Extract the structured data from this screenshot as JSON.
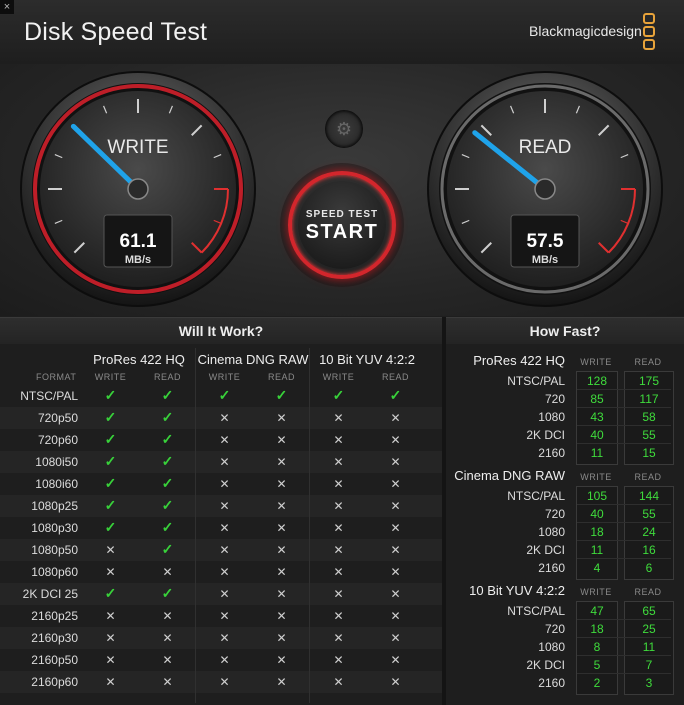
{
  "window": {
    "close_glyph": "×"
  },
  "header": {
    "title": "Disk Speed Test",
    "brand": "Blackmagicdesign"
  },
  "write_gauge": {
    "label": "WRITE",
    "value": "61.1",
    "unit": "MB/s",
    "needle_fraction": 0.33
  },
  "read_gauge": {
    "label": "READ",
    "value": "57.5",
    "unit": "MB/s",
    "needle_fraction": 0.31
  },
  "start_button": {
    "small": "SPEED TEST",
    "big": "START"
  },
  "settings_icon": "gear-icon",
  "will_it_work": {
    "title": "Will It Work?",
    "format_header": "FORMAT",
    "write_header": "WRITE",
    "read_header": "READ",
    "groups": [
      "ProRes 422 HQ",
      "Cinema DNG RAW",
      "10 Bit YUV 4:2:2"
    ],
    "rows": [
      {
        "format": "NTSC/PAL",
        "cells": [
          1,
          1,
          1,
          1,
          1,
          1
        ]
      },
      {
        "format": "720p50",
        "cells": [
          1,
          1,
          0,
          0,
          0,
          0
        ]
      },
      {
        "format": "720p60",
        "cells": [
          1,
          1,
          0,
          0,
          0,
          0
        ]
      },
      {
        "format": "1080i50",
        "cells": [
          1,
          1,
          0,
          0,
          0,
          0
        ]
      },
      {
        "format": "1080i60",
        "cells": [
          1,
          1,
          0,
          0,
          0,
          0
        ]
      },
      {
        "format": "1080p25",
        "cells": [
          1,
          1,
          0,
          0,
          0,
          0
        ]
      },
      {
        "format": "1080p30",
        "cells": [
          1,
          1,
          0,
          0,
          0,
          0
        ]
      },
      {
        "format": "1080p50",
        "cells": [
          0,
          1,
          0,
          0,
          0,
          0
        ]
      },
      {
        "format": "1080p60",
        "cells": [
          0,
          0,
          0,
          0,
          0,
          0
        ]
      },
      {
        "format": "2K DCI 25",
        "cells": [
          1,
          1,
          0,
          0,
          0,
          0
        ]
      },
      {
        "format": "2160p25",
        "cells": [
          0,
          0,
          0,
          0,
          0,
          0
        ]
      },
      {
        "format": "2160p30",
        "cells": [
          0,
          0,
          0,
          0,
          0,
          0
        ]
      },
      {
        "format": "2160p50",
        "cells": [
          0,
          0,
          0,
          0,
          0,
          0
        ]
      },
      {
        "format": "2160p60",
        "cells": [
          0,
          0,
          0,
          0,
          0,
          0
        ]
      }
    ],
    "check_glyph": "✓",
    "cross_glyph": "✕"
  },
  "how_fast": {
    "title": "How Fast?",
    "write_header": "WRITE",
    "read_header": "READ",
    "groups": [
      {
        "name": "ProRes 422 HQ",
        "rows": [
          {
            "label": "NTSC/PAL",
            "write": "128",
            "read": "175"
          },
          {
            "label": "720",
            "write": "85",
            "read": "117"
          },
          {
            "label": "1080",
            "write": "43",
            "read": "58"
          },
          {
            "label": "2K DCI",
            "write": "40",
            "read": "55"
          },
          {
            "label": "2160",
            "write": "11",
            "read": "15"
          }
        ]
      },
      {
        "name": "Cinema DNG RAW",
        "rows": [
          {
            "label": "NTSC/PAL",
            "write": "105",
            "read": "144"
          },
          {
            "label": "720",
            "write": "40",
            "read": "55"
          },
          {
            "label": "1080",
            "write": "18",
            "read": "24"
          },
          {
            "label": "2K DCI",
            "write": "11",
            "read": "16"
          },
          {
            "label": "2160",
            "write": "4",
            "read": "6"
          }
        ]
      },
      {
        "name": "10 Bit YUV 4:2:2",
        "rows": [
          {
            "label": "NTSC/PAL",
            "write": "47",
            "read": "65"
          },
          {
            "label": "720",
            "write": "18",
            "read": "25"
          },
          {
            "label": "1080",
            "write": "8",
            "read": "11"
          },
          {
            "label": "2K DCI",
            "write": "5",
            "read": "7"
          },
          {
            "label": "2160",
            "write": "2",
            "read": "3"
          }
        ]
      }
    ]
  },
  "colors": {
    "accent_red": "#d3262c",
    "needle_blue": "#1fa3ea",
    "ok_green": "#38d23a"
  }
}
